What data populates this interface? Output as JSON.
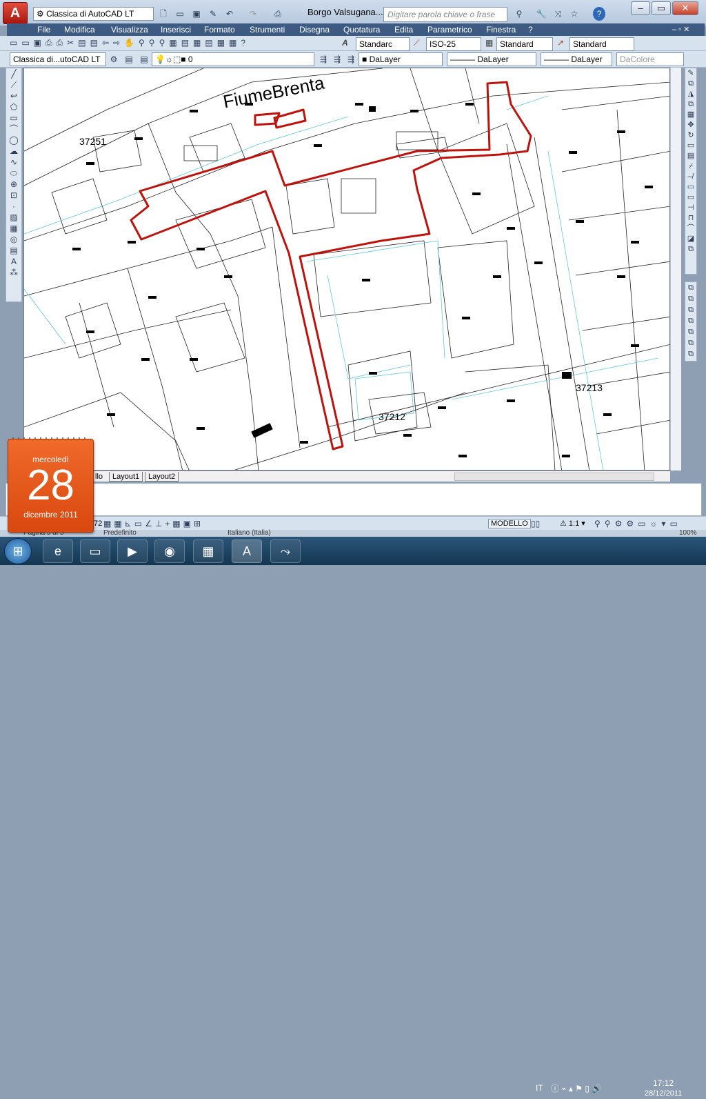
{
  "title_bar": {
    "workspace": "Classica di AutoCAD LT",
    "document": "Borgo Valsugana...",
    "search_placeholder": "Digitare parola chiave o frase"
  },
  "menu": [
    "File",
    "Modifica",
    "Visualizza",
    "Inserisci",
    "Formato",
    "Strumenti",
    "Disegna",
    "Quotatura",
    "Edita",
    "Parametrico",
    "Finestra",
    "?"
  ],
  "toolbar2": {
    "text_style": "Standarc",
    "dim_style": "ISO-25",
    "table_style": "Standard",
    "multileader_style": "Standard"
  },
  "toolbar3": {
    "workspace_short": "Classica di...utoCAD LT",
    "layer": "0",
    "color": "DaLayer",
    "linetype": "DaLayer",
    "lineweight": "DaLayer",
    "plotstyle": "DaColore"
  },
  "drawing": {
    "labels": [
      "FiumeBrenta",
      "37251",
      "37213",
      "37212"
    ]
  },
  "layout_tabs": [
    "llo",
    "Layout1",
    "Layout2"
  ],
  "statusbar": {
    "model": "MODELLO",
    "scale": "1:1",
    "coords_partial": "72"
  },
  "statusbar_lower": {
    "left": "Pagina 5 di 5",
    "mid1": "Predefinito",
    "mid2": "Italiano (Italia)",
    "right": "100%"
  },
  "calendar": {
    "weekday": "mercoledì",
    "day": "28",
    "month_year": "dicembre 2011"
  },
  "taskbar": {
    "lang": "IT",
    "time": "17:12",
    "date": "28/12/2011"
  },
  "colors": {
    "accent_red": "#c0120c",
    "cyan_lines": "#5ec8e0",
    "calendar": "#e65a1c"
  }
}
